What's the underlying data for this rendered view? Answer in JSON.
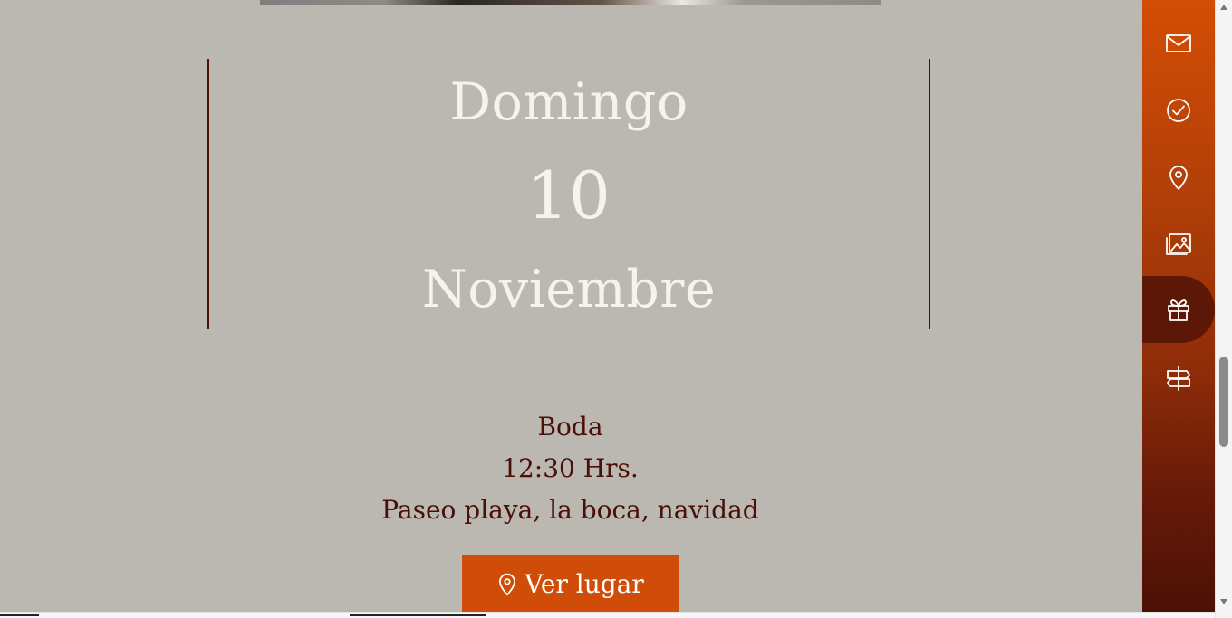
{
  "date": {
    "day": "Domingo",
    "number": "10",
    "month": "Noviembre"
  },
  "event": {
    "type": "Boda",
    "time": "12:30 Hrs.",
    "place": "Paseo playa, la boca, navidad"
  },
  "location_button": {
    "label": "Ver lugar",
    "icon": "map-pin-icon"
  },
  "side_menu": {
    "items": [
      {
        "icon": "mail-icon"
      },
      {
        "icon": "check-circle-icon"
      },
      {
        "icon": "map-pin-icon"
      },
      {
        "icon": "gallery-icon"
      },
      {
        "icon": "gift-icon",
        "active": true
      },
      {
        "icon": "signpost-icon"
      }
    ]
  },
  "colors": {
    "background": "#bbb8b1",
    "accent": "#cf4d08",
    "dark_red": "#4a0f08",
    "date_text": "#f6f3ef"
  }
}
